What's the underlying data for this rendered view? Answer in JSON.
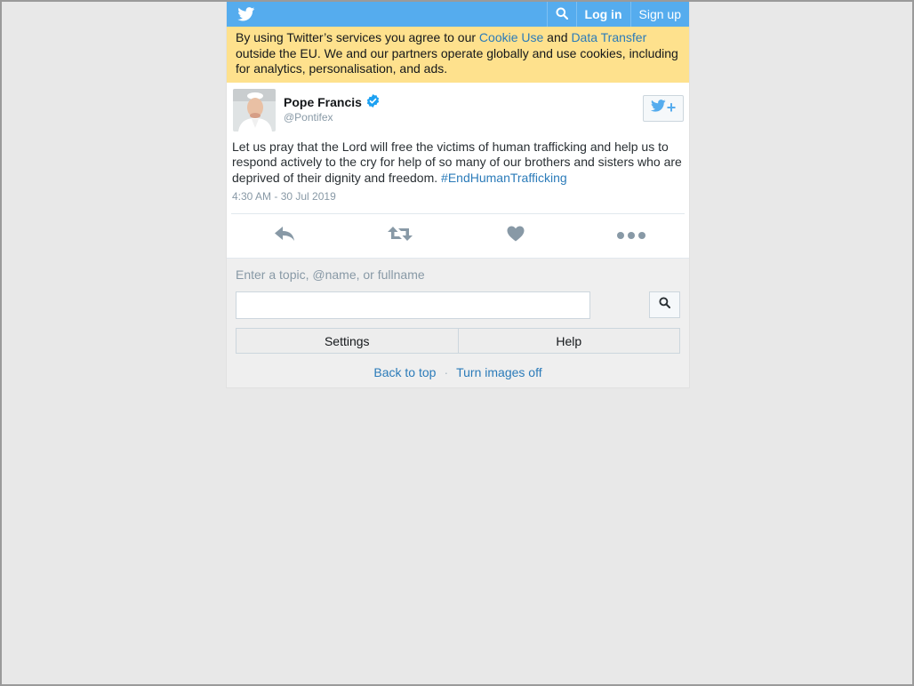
{
  "header": {
    "login_label": "Log in",
    "signup_label": "Sign up"
  },
  "cookie_notice": {
    "text_before": "By using Twitter’s services you agree to our ",
    "cookie_link": "Cookie Use",
    "text_middle": " and ",
    "transfer_link": "Data Transfer",
    "text_after": " outside the EU. We and our partners operate globally and use cookies, including for analytics, personalisation, and ads."
  },
  "tweet": {
    "author_name": "Pope Francis",
    "author_handle": "@Pontifex",
    "text": "Let us pray that the Lord will free the victims of human trafficking and help us to respond actively to the cry for help of so many of our brothers and sisters who are deprived of their dignity and freedom. ",
    "hashtag": "#EndHumanTrafficking",
    "timestamp": "4:30 AM - 30 Jul 2019"
  },
  "search": {
    "label": "Enter a topic, @name, or fullname",
    "value": ""
  },
  "bottom_buttons": {
    "settings_label": "Settings",
    "help_label": "Help"
  },
  "footer": {
    "back_to_top": "Back to top",
    "separator": "·",
    "images_off": "Turn images off"
  },
  "colors": {
    "brand_blue": "#55acee",
    "link_blue": "#2b7bb9",
    "cookie_bg": "#fee18d",
    "verified_blue": "#1da1f2"
  }
}
